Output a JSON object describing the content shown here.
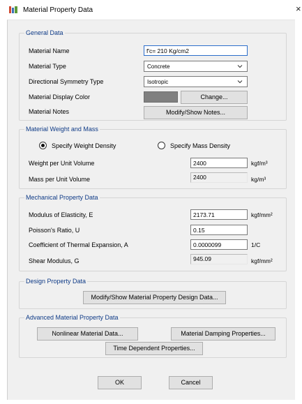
{
  "window": {
    "title": "Material Property Data",
    "close_glyph": "×"
  },
  "general": {
    "legend": "General Data",
    "material_name_label": "Material Name",
    "material_name_value": "f'c= 210 Kg/cm2",
    "material_type_label": "Material Type",
    "material_type_value": "Concrete",
    "symmetry_label": "Directional Symmetry Type",
    "symmetry_value": "Isotropic",
    "display_color_label": "Material Display Color",
    "display_color_hex": "#808080",
    "change_button": "Change...",
    "notes_label": "Material Notes",
    "notes_button": "Modify/Show Notes..."
  },
  "weight_mass": {
    "legend": "Material Weight and Mass",
    "radio_weight": "Specify Weight Density",
    "radio_mass": "Specify Mass Density",
    "selected": "weight",
    "weight_label": "Weight per Unit Volume",
    "weight_value": "2400",
    "weight_unit": "kgf/m³",
    "mass_label": "Mass per Unit Volume",
    "mass_value": "2400",
    "mass_unit": "kg/m³"
  },
  "mechanical": {
    "legend": "Mechanical Property Data",
    "modulus_label": "Modulus of Elasticity,  E",
    "modulus_value": "2173.71",
    "modulus_unit": "kgf/mm²",
    "poisson_label": "Poisson's Ratio,  U",
    "poisson_value": "0.15",
    "thermal_label": "Coefficient of Thermal Expansion,  A",
    "thermal_value": "0.0000099",
    "thermal_unit": "1/C",
    "shear_label": "Shear Modulus,  G",
    "shear_value": "945.09",
    "shear_unit": "kgf/mm²"
  },
  "design": {
    "legend": "Design Property Data",
    "button": "Modify/Show Material Property Design Data..."
  },
  "advanced": {
    "legend": "Advanced Material Property Data",
    "nonlinear_button": "Nonlinear Material Data...",
    "damping_button": "Material Damping Properties...",
    "time_button": "Time Dependent Properties..."
  },
  "footer": {
    "ok": "OK",
    "cancel": "Cancel"
  },
  "colors": {
    "legend_text": "#0e3a86",
    "dialog_bg": "#f0f0f0",
    "focus_border": "#2c6ecb"
  }
}
